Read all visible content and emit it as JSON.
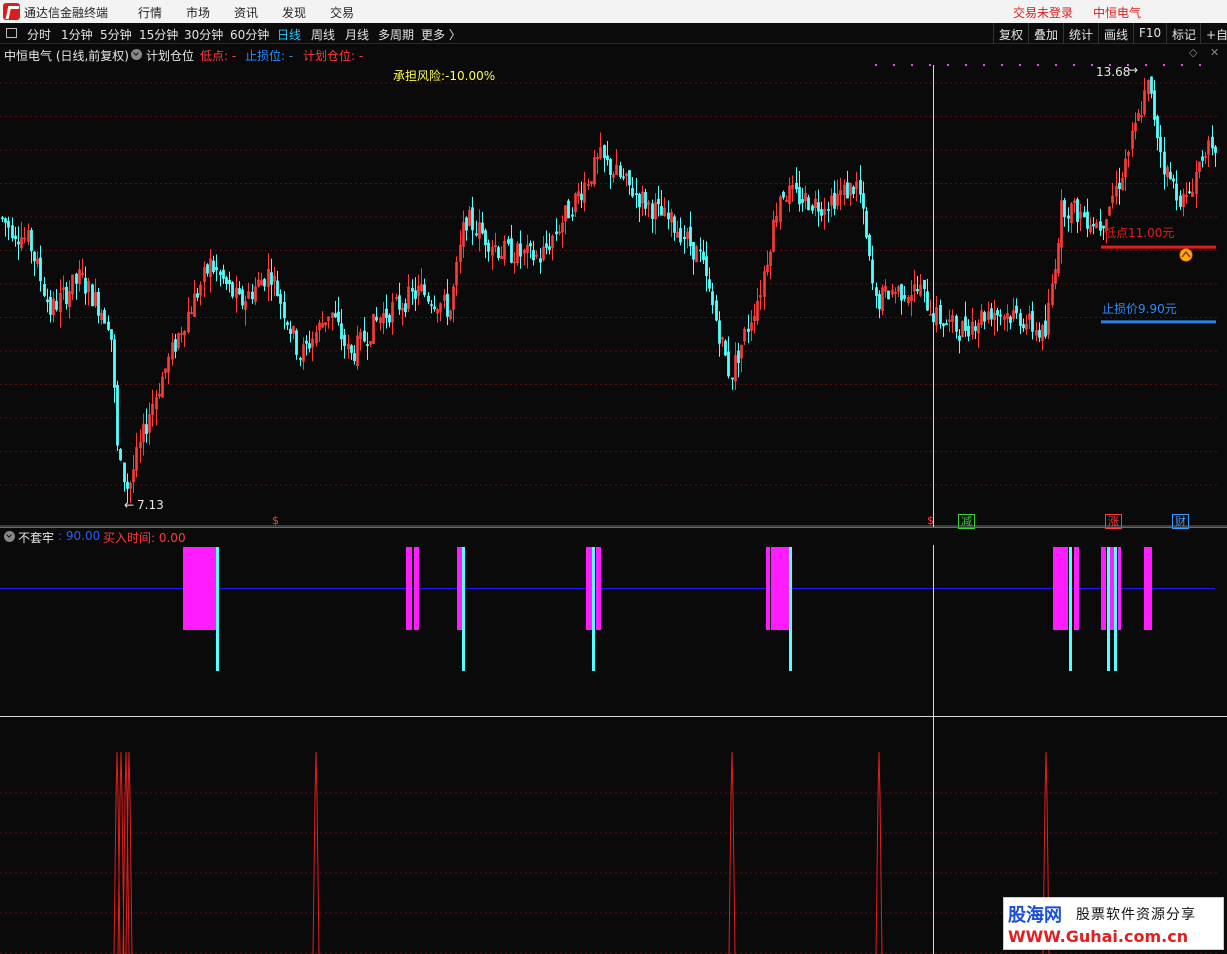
{
  "titlebar": {
    "app_title": "通达信金融终端",
    "menus": [
      "行情",
      "市场",
      "资讯",
      "发现",
      "交易"
    ],
    "login_status": "交易未登录",
    "stock_name": "中恒电气"
  },
  "toolbar": {
    "periods": [
      "分时",
      "1分钟",
      "5分钟",
      "15分钟",
      "30分钟",
      "60分钟",
      "日线",
      "周线",
      "月线",
      "多周期",
      "更多 〉"
    ],
    "active_period": "日线",
    "right_buttons": [
      "复权",
      "叠加",
      "统计",
      "画线",
      "F10",
      "标记",
      "+自"
    ]
  },
  "main_chart": {
    "title": "中恒电气 (日线,前复权)",
    "indicator_name": "计划仓位",
    "low_label": "低点: -",
    "stop_label": "止损位: -",
    "plan_label": "计划仓位: -",
    "risk_label": "承担风险:-10.00%",
    "high_price_label": "13.68",
    "low_price_label": "7.13",
    "low_point_label": "低点11.00元",
    "stop_price_label": "止损价9.90元",
    "low_point_price": 11.0,
    "stop_price": 9.9,
    "high_price": 13.68,
    "low_price": 7.13,
    "colors": {
      "up": "#ff3b3b",
      "down": "#54ffff",
      "low_line": "#e41e1e",
      "stop_line": "#2a7fe8",
      "risk": "#ffff4c"
    },
    "event_badges": [
      {
        "label": "$",
        "color": "#ff3b3b"
      },
      {
        "label": "$",
        "color": "#ff3b3b"
      },
      {
        "label": "减",
        "color": "#3ad13a"
      },
      {
        "label": "涨",
        "color": "#ff3b3b"
      },
      {
        "label": "财",
        "color": "#3aa0ff"
      }
    ]
  },
  "indicator": {
    "name": "不套牢",
    "value_label": ": 90.00",
    "buy_label": "买入时间: 0.00",
    "level": 90.0,
    "colors": {
      "bar": "#ff1dff",
      "signal": "#54ffff",
      "line": "#1a1aff"
    }
  },
  "watermark": {
    "brand": "股海网",
    "slogan": "股票软件资源分享",
    "url": "WWW.Guhai.com.cn"
  }
}
